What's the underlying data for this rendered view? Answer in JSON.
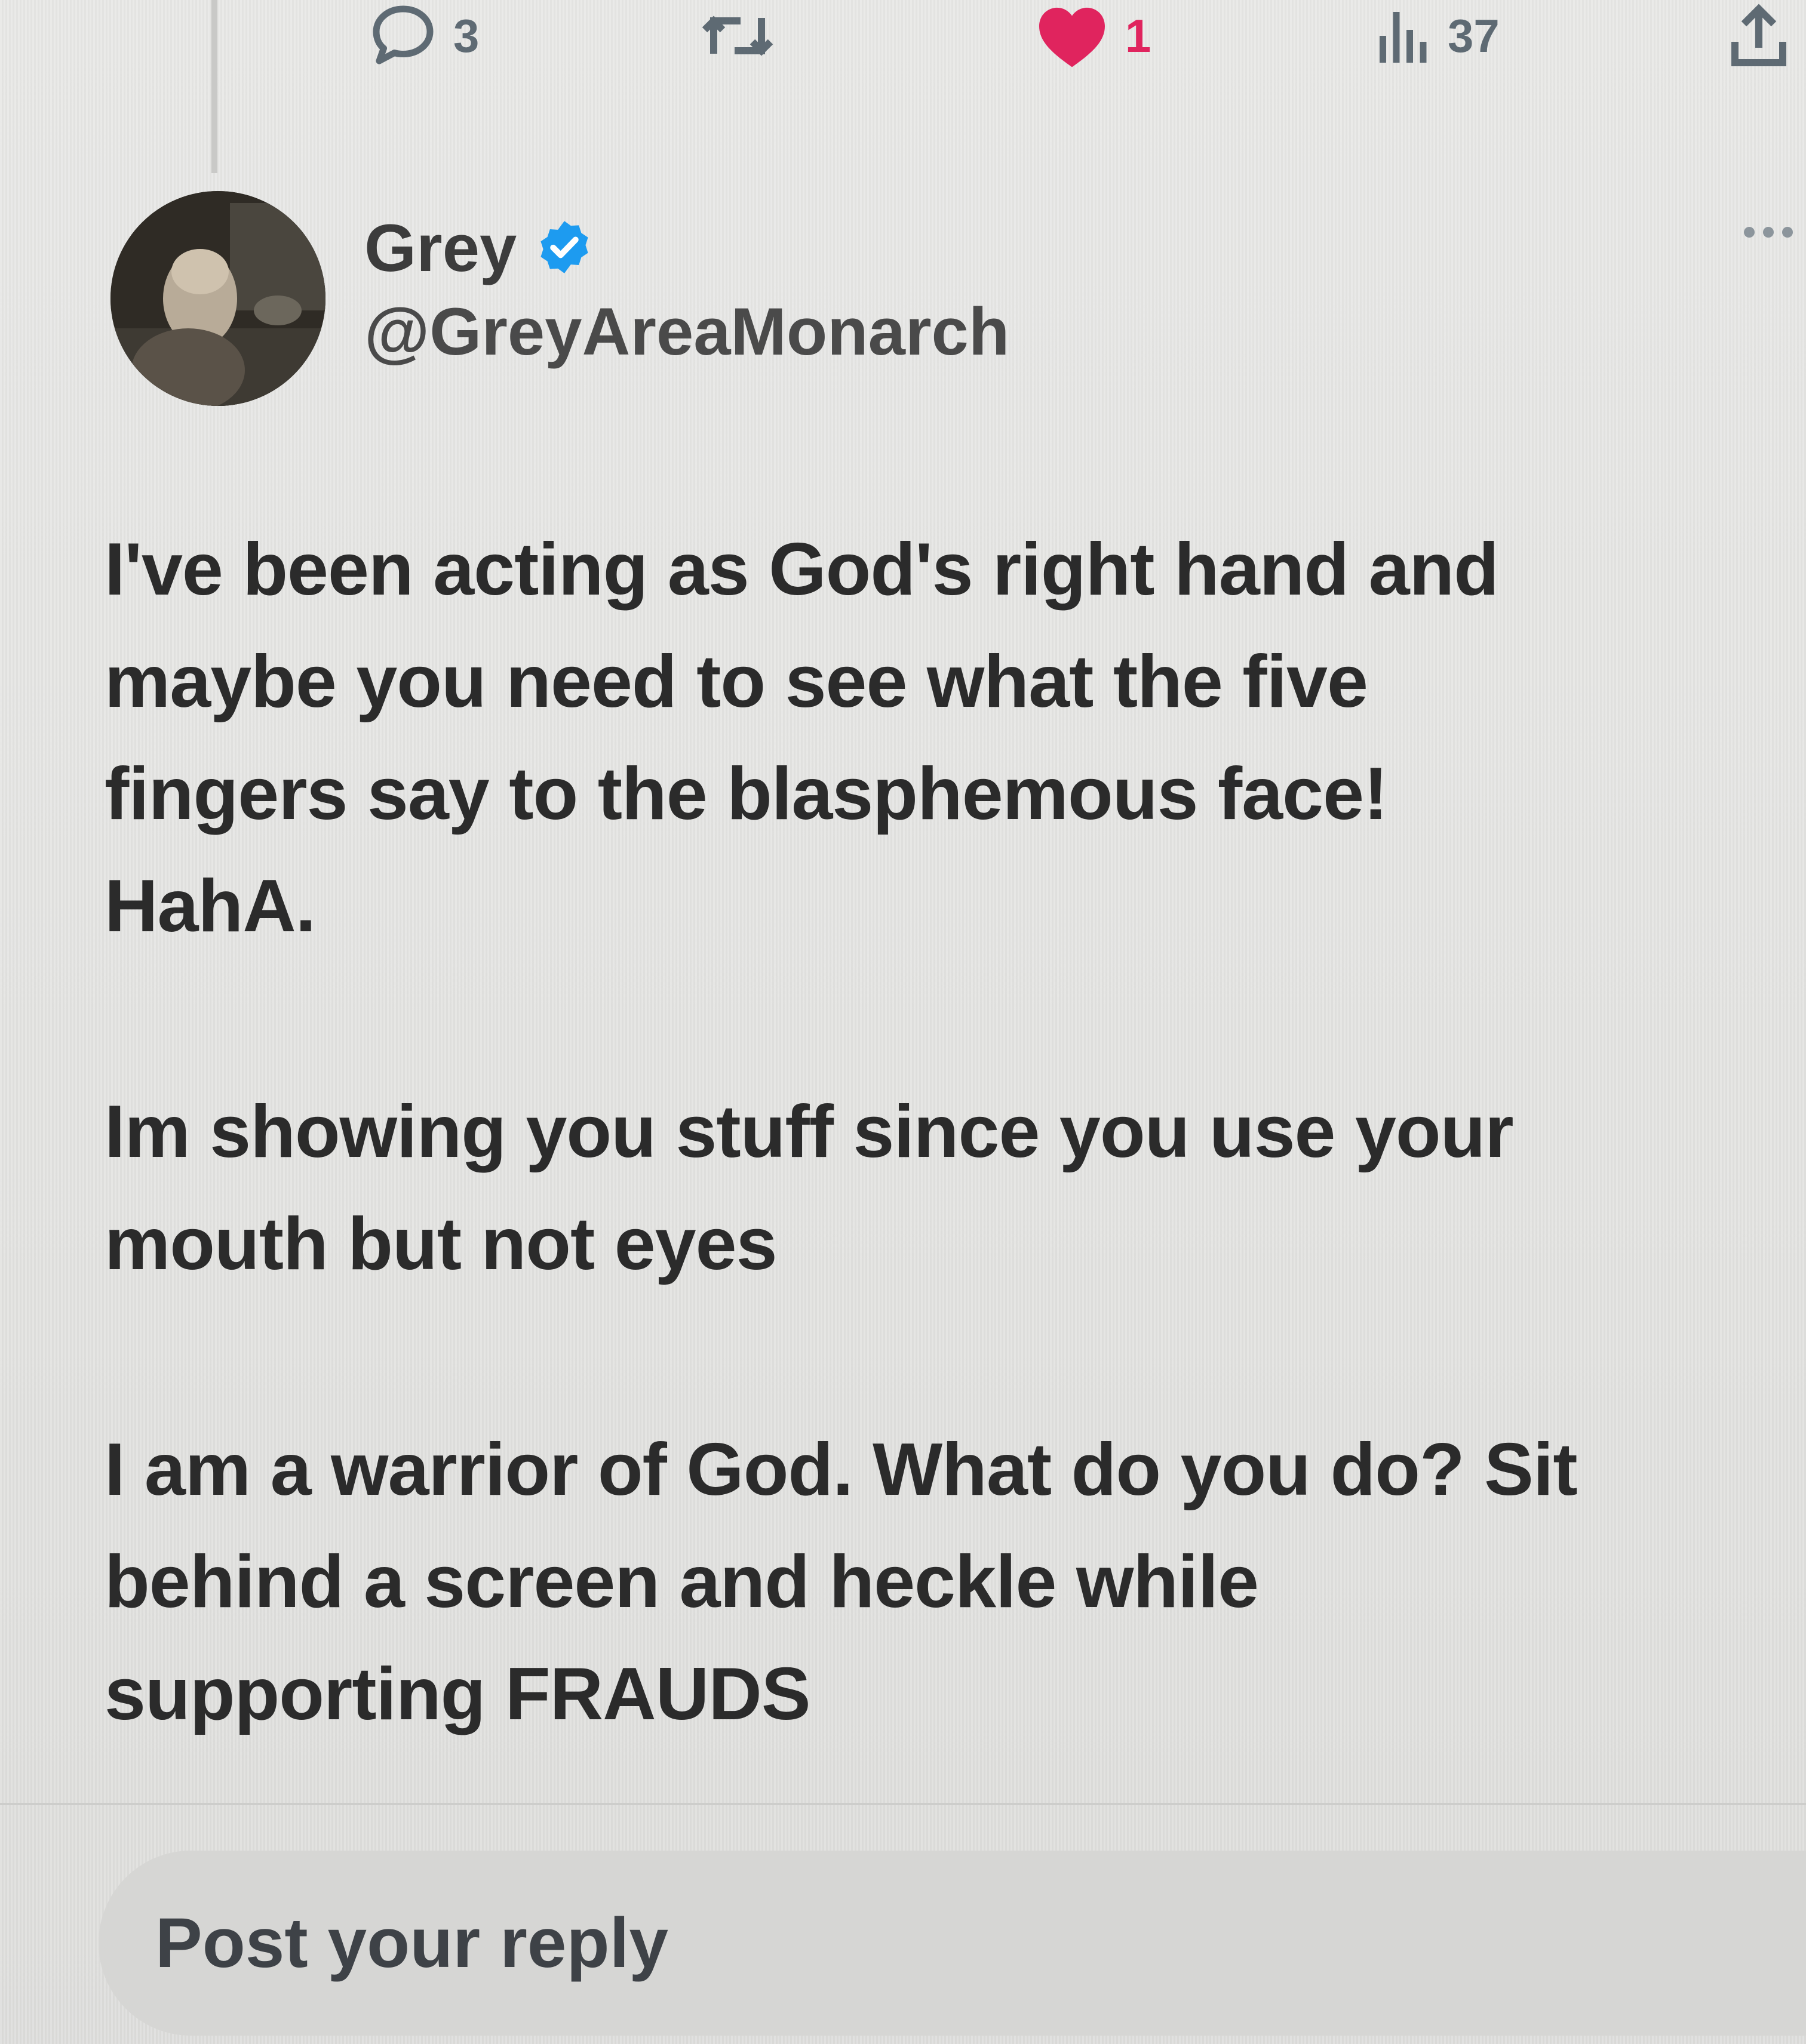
{
  "previous_post": {
    "actions": {
      "reply_count": "3",
      "repost_count": "",
      "like_count": "1",
      "view_count": "37"
    },
    "like_color": "#e0245e"
  },
  "author": {
    "display_name": "Grey",
    "handle": "@GreyAreaMonarch",
    "verified": true,
    "verified_color": "#1d9bf0"
  },
  "post": {
    "paragraphs": [
      {
        "lines": [
          "I've been acting as God's right hand and",
          "maybe you need to see what the five",
          "fingers say to the blasphemous face!",
          "HahA."
        ]
      },
      {
        "lines": [
          "Im showing you stuff since you use your",
          "mouth but not eyes"
        ]
      },
      {
        "lines": [
          "I am a warrior of God. What do you do? Sit",
          "behind a screen and heckle while",
          "supporting FRAUDS"
        ]
      }
    ]
  },
  "reply": {
    "placeholder": "Post your reply"
  },
  "icons": {
    "reply": "reply-bubble-icon",
    "repost": "repost-icon",
    "like": "heart-icon",
    "views": "views-chart-icon",
    "share": "share-icon",
    "verified": "verified-badge-icon",
    "more": "more-dots-icon"
  }
}
